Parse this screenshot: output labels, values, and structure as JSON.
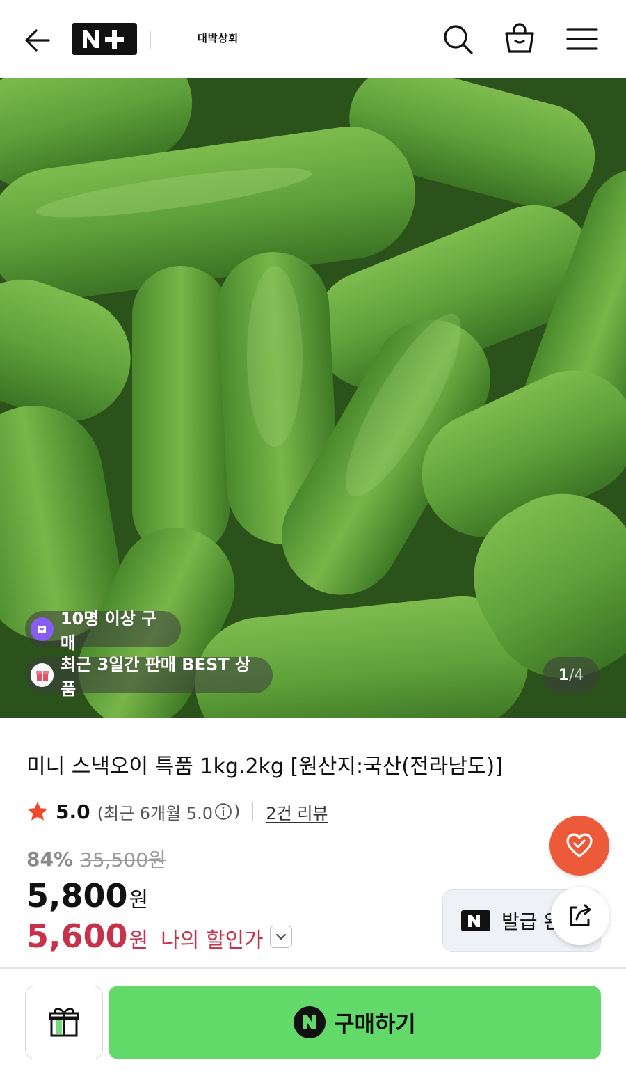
{
  "header": {
    "back_icon": "arrow-left-icon",
    "logo_text": "N+",
    "store_name": "대박상회",
    "search_icon": "search-icon",
    "cart_icon": "cart-icon",
    "menu_icon": "menu-icon"
  },
  "gallery": {
    "image_alt": "cucumbers",
    "badges": [
      {
        "icon": "shopping-bag-icon",
        "text": "10명 이상 구매",
        "color": "#8a5cf6"
      },
      {
        "icon": "gift-box-icon",
        "text": "최근 3일간 판매 BEST 상품",
        "color": "#e8506a"
      }
    ],
    "counter": {
      "current": "1",
      "separator": "/",
      "total": "4"
    }
  },
  "product": {
    "title": "미니 스낵오이 특품 1kg.2kg [원산지:국산(전라남도)]",
    "rating": {
      "value": "5.0",
      "recent_prefix": "(최근 6개월 5.0",
      "recent_suffix": ")",
      "review_link": "2건 리뷰"
    },
    "discount_rate": "84%",
    "original_price": "35,500원",
    "sale_price": "5,800",
    "currency": "원",
    "my_price": "5,600",
    "my_price_label": "나의 할인가"
  },
  "actions": {
    "wish_icon": "heart-check-icon",
    "coupon_label": "발급 완",
    "share_icon": "share-icon",
    "gift_icon": "gift-icon",
    "buy_label": "구매하기"
  },
  "colors": {
    "accent_red": "#c8314a",
    "wish_orange": "#ec5a3a",
    "buy_green": "#63d96a",
    "star": "#f04a2a"
  }
}
